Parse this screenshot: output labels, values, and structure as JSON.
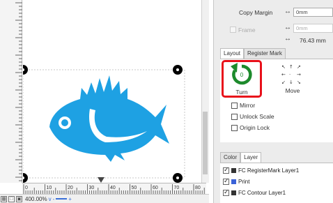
{
  "design": {
    "fill_color": "#1ea1e3",
    "handle_color": "#000000",
    "frame_color": "#c7c7c7"
  },
  "rulers": {
    "horizontal_ticks": [
      "0",
      "10",
      "20",
      "30",
      "40",
      "50",
      "60",
      "70",
      "80"
    ]
  },
  "status_bar": {
    "zoom": "400.00%",
    "zoom_dropdown_glyph": "v",
    "zoom_out": "-",
    "zoom_in": "+"
  },
  "properties": {
    "copy_margin_label": "Copy Margin",
    "copy_margin_value": "0mm",
    "frame_label": "Frame",
    "frame_value": "0mm",
    "frame_readout": "76.43 mm"
  },
  "layout_tabs": {
    "items": [
      {
        "label": "Layout"
      },
      {
        "label": "Register Mark"
      }
    ]
  },
  "layout": {
    "turn_label": "Turn",
    "turn_counter": "0",
    "move_label": "Move",
    "mirror_label": "Mirror",
    "unlock_scale_label": "Unlock Scale",
    "origin_lock_label": "Origin Lock",
    "accent_color": "#1d8a2c",
    "highlight_color": "#e8101a"
  },
  "layer_tabs": {
    "items": [
      {
        "label": "Color"
      },
      {
        "label": "Layer"
      }
    ]
  },
  "layers": [
    {
      "name": "FC RegisterMark Layer1",
      "color": "#333333"
    },
    {
      "name": "Print",
      "color": "#3a62d8"
    },
    {
      "name": "FC Contour Layer1",
      "color": "#333333"
    }
  ]
}
